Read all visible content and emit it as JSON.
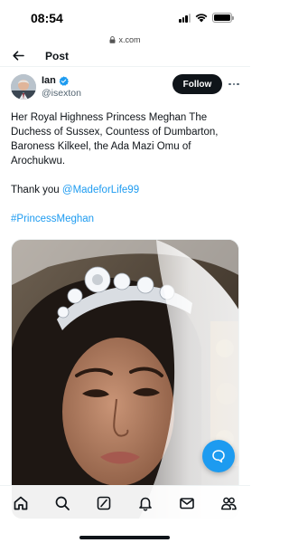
{
  "status_bar": {
    "time": "08:54",
    "battery_level": 1.0
  },
  "browser": {
    "url": "x.com",
    "lock_icon": "lock-icon"
  },
  "header": {
    "back_icon": "arrow-left-icon",
    "title": "Post"
  },
  "post": {
    "author_name": "Ian",
    "author_handle": "@isexton",
    "verified": true,
    "follow_label": "Follow",
    "text_line1": "Her Royal Highness Princess Meghan The Duchess of Sussex, Countess of Dumbarton, Baroness Kilkeel, the Ada Mazi Omu of Arochukwu.",
    "thanks_prefix": "Thank you ",
    "mention": "@MadeforLife99",
    "hashtag": "#PrincessMeghan",
    "media_icon": "photo"
  },
  "colors": {
    "accent": "#1d9bf0",
    "text": "#0f1419",
    "secondary": "#536471",
    "follow_bg": "#0f1419"
  },
  "tab_bar": {
    "items": [
      {
        "name": "home",
        "icon": "home-icon",
        "active": true
      },
      {
        "name": "search",
        "icon": "search-icon",
        "active": false
      },
      {
        "name": "grok",
        "icon": "grok-icon",
        "active": false
      },
      {
        "name": "notifications",
        "icon": "bell-icon",
        "active": false
      },
      {
        "name": "messages",
        "icon": "envelope-icon",
        "active": false
      },
      {
        "name": "communities",
        "icon": "people-icon",
        "active": false
      }
    ]
  },
  "fab": {
    "icon": "reply-bubble-icon"
  }
}
